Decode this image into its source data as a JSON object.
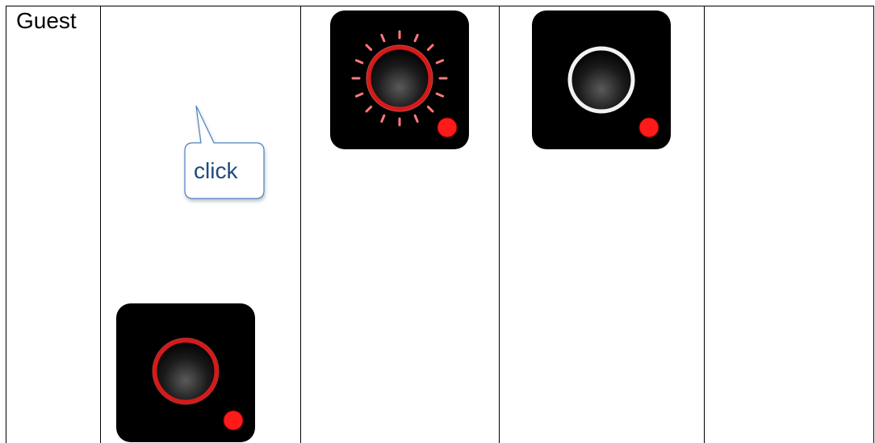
{
  "table": {
    "row_label": "Guest"
  },
  "callout": {
    "text": "click"
  },
  "buttons": [
    {
      "state": "pressed",
      "ring_color": "#e01b1b",
      "indicator_color": "#ff1a1a",
      "icon": "record-button-icon"
    },
    {
      "state": "glowing",
      "ring_color": "#e01b1b",
      "indicator_color": "#ff1a1a",
      "icon": "record-button-glow-icon"
    },
    {
      "state": "idle",
      "ring_color": "#ffffff",
      "indicator_color": "#ff1a1a",
      "icon": "record-button-idle-icon"
    }
  ]
}
